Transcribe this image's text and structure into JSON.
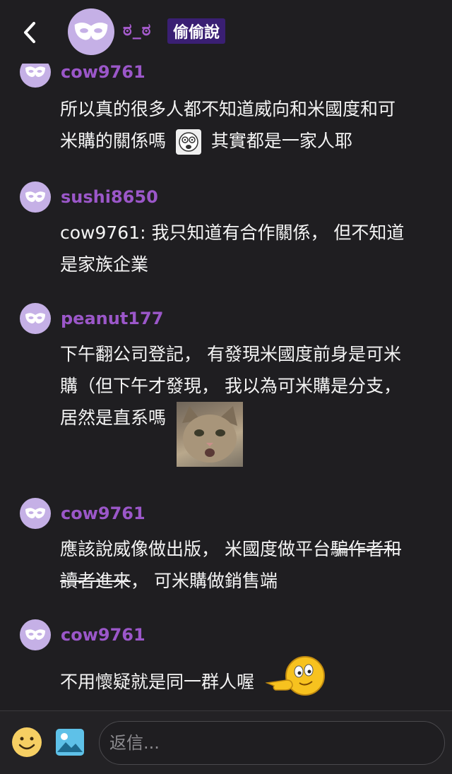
{
  "header": {
    "title": "ಠ_ಠ",
    "badge": "偷偷說"
  },
  "messages": [
    {
      "user": "cow9761",
      "line1": "所以真的很多人都不知道威向和米國度和可",
      "line2a": "米購的關係嗎",
      "line2b": "其實都是一家人耶"
    },
    {
      "user": "sushi8650",
      "line1": "cow9761: 我只知道有合作關係， 但不知道",
      "line2": "是家族企業"
    },
    {
      "user": "peanut177",
      "line1": "下午翻公司登記， 有發現米國度前身是可米",
      "line2": "購（但下午才發現， 我以為可米購是分支，",
      "line3": "居然是直系嗎"
    },
    {
      "user": "cow9761",
      "line1a": "應該說威像做出版， 米國度做平台",
      "line1b": "騙作者和",
      "line2a": "讀者進來",
      "line2b": "， 可米購做銷售端"
    },
    {
      "user": "cow9761",
      "line1": "不用懷疑就是同一群人喔"
    }
  ],
  "footer": {
    "placeholder": "返信..."
  },
  "colors": {
    "background": "#1f1e21",
    "username": "#9b57c9",
    "avatar": "#c5b0e6",
    "badge": "#3a1f73"
  },
  "icons": [
    "back-chevron-icon",
    "mask-icon",
    "emoji-icon",
    "image-icon",
    "pointing-emoji-icon"
  ]
}
